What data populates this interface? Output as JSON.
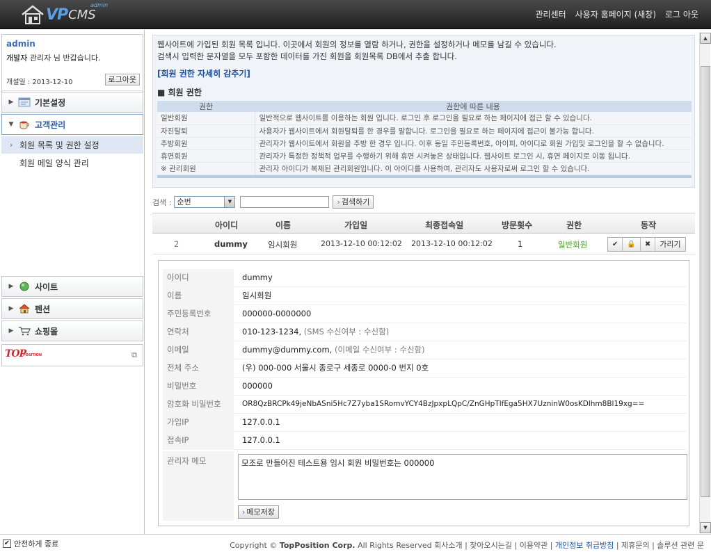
{
  "header": {
    "logo_vp": "VP",
    "logo_cms": "CMS",
    "logo_sup": "admin",
    "nav": [
      "관리센터",
      "사용자 홈페이지 (새창)",
      "로그 아웃"
    ]
  },
  "sidebar": {
    "user_name": "admin",
    "greet_role": "개발자",
    "greet_rest": " 관리자 님 반갑습니다.",
    "open_date": "개설일 : 2013-12-10",
    "logout": "로그아웃",
    "menus": {
      "basic": "기본설정",
      "customer": "고객관리",
      "site": "사이트",
      "pension": "펜션",
      "shop": "쇼핑몰"
    },
    "subs": [
      "회원 목록 및 권한 설정",
      "회원 메일 양식 관리"
    ],
    "brand": "TOP",
    "brand_sub": "POSITION"
  },
  "info": {
    "line1": "웹사이트에 가입된 회원 목록 입니다. 이곳에서 회원의 정보를 열람 하거나, 권한을 설정하거나 메모를 남길 수 있습니다.",
    "line2": "검색시 입력한 문자열을 모두 포함한 데이터를 가진 회원을 회원목록 DB에서 추출 합니다.",
    "toggle": "[회원 권한 자세히 감추기]",
    "section": "■ 회원 권한",
    "col_role": "권한",
    "col_desc": "권한에 따른 내용",
    "roles": [
      {
        "role": "일반회원",
        "desc": "일반적으로 웹사이트를 이용하는 회원 입니다. 로그인 후 로그인을 필요로 하는 페이지에 접근 할 수 있습니다."
      },
      {
        "role": "자진탈퇴",
        "desc": "사용자가 웹사이트에서 회원탈퇴를 한 경우를 말합니다. 로그인을 필요로 하는 페이지에 접근이 불가능 합니다."
      },
      {
        "role": "추방회원",
        "desc": "관리자가 웹사이트에서 회원을 추방 한 경우 입니다. 이후 동일 주민등록번호, 아이피, 아이디로 회원 가입및 로그인을 할 수 없습니다."
      },
      {
        "role": "휴면회원",
        "desc": "관리자가 특정한 정책적 업무를 수행하기 위해 휴면 시켜놓은 상태입니다. 웹사이트 로그인 시, 휴면 페이지로 이동 됩니다."
      },
      {
        "role": "※ 관리회원",
        "desc": "관리자 아이디가 복제된 관리회원입니다. 이 아이디를 사용하여, 관리자도 사용자로써 로그인 할 수 있습니다."
      }
    ]
  },
  "search": {
    "label": "검색 :",
    "select": "순번",
    "input": "",
    "button": "검색하기"
  },
  "grid": {
    "headers": [
      "아이디",
      "이름",
      "가입일",
      "최종접속일",
      "방문횟수",
      "권한",
      "동작"
    ],
    "row": {
      "no": "2",
      "id": "dummy",
      "name": "임시회원",
      "joined": "2013-12-10 00:12:02",
      "last": "2013-12-10 00:12:02",
      "visits": "1",
      "role": "일반회원",
      "act_check": "✔",
      "act_lock": "🔒",
      "act_delete": "✖",
      "act_hide": "가리기"
    },
    "role_color": "#4aa020"
  },
  "detail": {
    "rows": [
      {
        "k": "아이디",
        "v": "dummy",
        "s": ""
      },
      {
        "k": "이름",
        "v": "임시회원",
        "s": ""
      },
      {
        "k": "주민등록번호",
        "v": "000000-0000000",
        "s": ""
      },
      {
        "k": "연락처",
        "v": "010-123-1234, ",
        "s": "(SMS 수신여부 : 수신함)"
      },
      {
        "k": "이메일",
        "v": "dummy@dummy.com, ",
        "s": "(이메일 수신여부 : 수신함)"
      },
      {
        "k": "전체 주소",
        "v": "(우) 000-000 서울시 종로구 세종로 0000-0 번지 0호",
        "s": ""
      },
      {
        "k": "비밀번호",
        "v": "000000",
        "s": ""
      },
      {
        "k": "암호화 비밀번호",
        "v": "OR8QzBRCPk49jeNbASni5Hc7Z7yba1SRomvYCY4BzJpxpLQpC/ZnGHpTlfEga5HX7UzninW0osKDlhm8Bl19xg==",
        "s": ""
      },
      {
        "k": "가입IP",
        "v": "127.0.0.1",
        "s": ""
      },
      {
        "k": "접속IP",
        "v": "127.0.0.1",
        "s": ""
      }
    ],
    "memo_label": "관리자 메모",
    "memo": "모조로 만들어진 테스트용 임시 회원 비밀번호는 000000",
    "memo_button": "메모저장"
  },
  "footer": {
    "safe_exit": "안전하게 종료",
    "copy_pre": "Copyright © ",
    "copy_corp": "TopPosition Corp.",
    "copy_mid": " All Rights Reserved ",
    "links": [
      "회사소개",
      "찾아오시는길",
      "이용약관",
      "개인정보 취급방침",
      "제휴문의",
      "솔루션 관련 문"
    ]
  },
  "colors": {
    "accent": "#3b6db5",
    "topbar": "#2b2b2b",
    "link_highlight": "#1e4e9c"
  }
}
